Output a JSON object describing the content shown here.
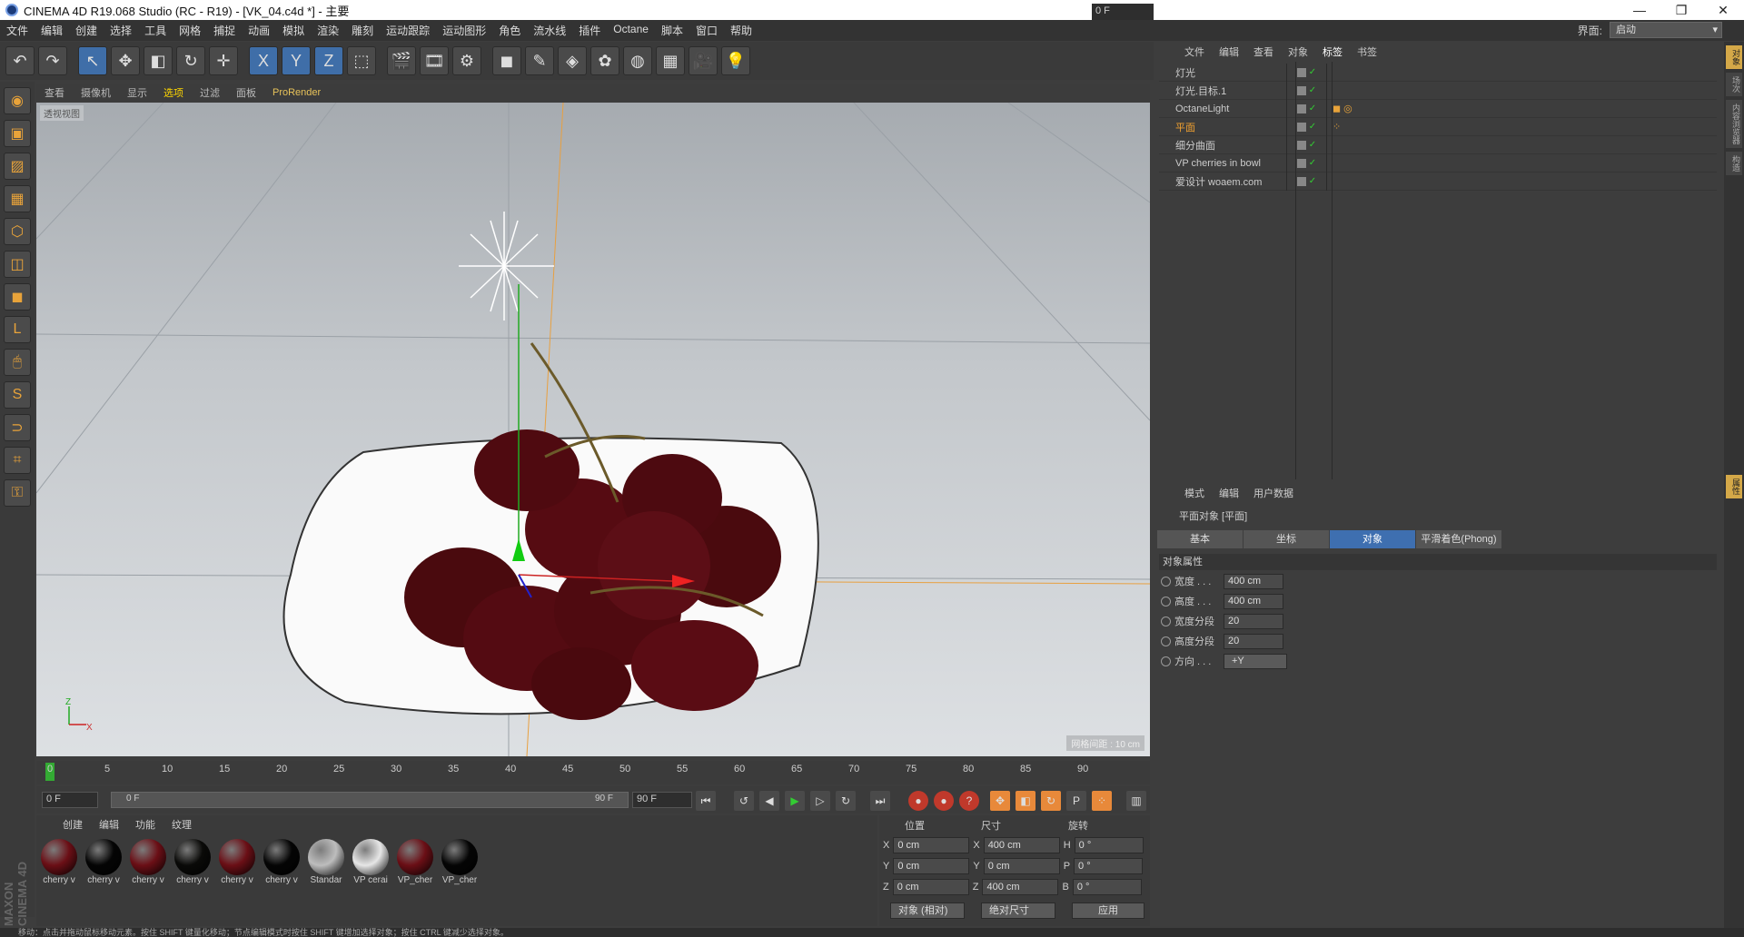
{
  "window": {
    "title": "CINEMA 4D R19.068 Studio (RC - R19) - [VK_04.c4d *] - 主要",
    "min": "—",
    "max": "❐",
    "close": "✕"
  },
  "menubar": {
    "items": [
      "文件",
      "编辑",
      "创建",
      "选择",
      "工具",
      "网格",
      "捕捉",
      "动画",
      "模拟",
      "渲染",
      "雕刻",
      "运动跟踪",
      "运动图形",
      "角色",
      "流水线",
      "插件",
      "Octane",
      "脚本",
      "窗口",
      "帮助"
    ],
    "interface_label": "界面:",
    "interface_value": "启动"
  },
  "toolbar": {
    "icons": [
      "undo-icon",
      "redo-icon",
      "select-icon",
      "move-icon",
      "scale-icon",
      "rotate-icon",
      "recent-icon",
      "x-axis-icon",
      "y-axis-icon",
      "z-axis-icon",
      "coord-system-icon",
      "render-view-icon",
      "render-picture-icon",
      "render-settings-icon",
      "cube-icon",
      "pen-icon",
      "subdivision-icon",
      "cloner-icon",
      "deformer-icon",
      "floor-icon",
      "camera-icon",
      "light-icon"
    ],
    "glyphs": [
      "↶",
      "↷",
      "↖",
      "✥",
      "◧",
      "↻",
      "✛",
      "X",
      "Y",
      "Z",
      "⬚",
      "🎬",
      "🎞",
      "⚙",
      "◼",
      "✎",
      "◈",
      "✿",
      "◍",
      "▦",
      "🎥",
      "💡"
    ]
  },
  "lefttools": {
    "icons": [
      "make-editable-icon",
      "model-mode-icon",
      "texture-mode-icon",
      "workplane-icon",
      "points-mode-icon",
      "edges-mode-icon",
      "polygons-mode-icon",
      "axis-mode-icon",
      "tweak-mode-icon",
      "solo-icon",
      "magnet-icon",
      "snap-icon",
      "lock-icon"
    ],
    "glyphs": [
      "◉",
      "▣",
      "▨",
      "▦",
      "⬡",
      "◫",
      "◼",
      "L",
      "🖱",
      "S",
      "⊃",
      "⌗",
      "⚿"
    ]
  },
  "maxon_logo": "MAXON CINEMA 4D",
  "viewport": {
    "menu": [
      "查看",
      "摄像机",
      "显示",
      "选项",
      "过滤",
      "面板",
      "ProRender"
    ],
    "active_menu": "选项",
    "label": "透视视图",
    "grid_label": "网格间距 : 10 cm",
    "axis_x": "X",
    "axis_y": "Z"
  },
  "timeline": {
    "ticks": [
      "0",
      "5",
      "10",
      "15",
      "20",
      "25",
      "30",
      "35",
      "40",
      "45",
      "50",
      "55",
      "60",
      "65",
      "70",
      "75",
      "80",
      "85",
      "90"
    ],
    "current": "0 F"
  },
  "playbar": {
    "start": "0 F",
    "range_start": "0 F",
    "range_end": "90 F",
    "end": "90 F"
  },
  "materials": {
    "menu": [
      "创建",
      "编辑",
      "功能",
      "纹理"
    ],
    "items": [
      {
        "label": "cherry v",
        "color": "#6b0f16"
      },
      {
        "label": "cherry v",
        "color": "#050505"
      },
      {
        "label": "cherry v",
        "color": "#6b0f16"
      },
      {
        "label": "cherry v",
        "color": "#0a0a08"
      },
      {
        "label": "cherry v",
        "color": "#6b0f16"
      },
      {
        "label": "cherry v",
        "color": "#050505"
      },
      {
        "label": "Standar",
        "color": "#bdbdbd"
      },
      {
        "label": "VP cerai",
        "color": "#e6e6e6"
      },
      {
        "label": "VP_cher",
        "color": "#6b0f16"
      },
      {
        "label": "VP_cher",
        "color": "#050505"
      }
    ]
  },
  "coords": {
    "headers": [
      "位置",
      "尺寸",
      "旋转"
    ],
    "rows": [
      {
        "axis": "X",
        "pos": "0 cm",
        "saxis": "X",
        "size": "400 cm",
        "raxis": "H",
        "rot": "0 °"
      },
      {
        "axis": "Y",
        "pos": "0 cm",
        "saxis": "Y",
        "size": "0 cm",
        "raxis": "P",
        "rot": "0 °"
      },
      {
        "axis": "Z",
        "pos": "0 cm",
        "saxis": "Z",
        "size": "400 cm",
        "raxis": "B",
        "rot": "0 °"
      }
    ],
    "mode": "对象 (相对)",
    "size_mode": "绝对尺寸",
    "apply": "应用"
  },
  "objects": {
    "menu": [
      "文件",
      "编辑",
      "查看",
      "对象",
      "标签",
      "书签"
    ],
    "active_menu": "标签",
    "items": [
      {
        "name": "灯光",
        "orange": false,
        "tags": ""
      },
      {
        "name": "灯光.目标.1",
        "orange": false,
        "tags": ""
      },
      {
        "name": "OctaneLight",
        "orange": false,
        "tags": "◼ ◎"
      },
      {
        "name": "平面",
        "orange": true,
        "tags": "⁘"
      },
      {
        "name": "细分曲面",
        "orange": false,
        "tags": ""
      },
      {
        "name": "VP cherries in bowl",
        "orange": false,
        "tags": ""
      },
      {
        "name": "爱设计 woaem.com",
        "orange": false,
        "tags": ""
      }
    ]
  },
  "attributes": {
    "menu": [
      "模式",
      "编辑",
      "用户数据"
    ],
    "object_title": "平面对象 [平面]",
    "tabs": [
      "基本",
      "坐标",
      "对象",
      "平滑着色(Phong)"
    ],
    "active_tab": "对象",
    "section": "对象属性",
    "fields": [
      {
        "label": "宽度 . . .",
        "value": "400 cm"
      },
      {
        "label": "高度 . . .",
        "value": "400 cm"
      },
      {
        "label": "宽度分段",
        "value": "20"
      },
      {
        "label": "高度分段",
        "value": "20"
      }
    ],
    "orientation_label": "方向 . . .",
    "orientation_value": "+Y"
  },
  "rightstrip": [
    "对象",
    "场次",
    "内容浏览器",
    "构造"
  ],
  "rightstrip_bottom": "属性",
  "statusbar": "移动：点击并拖动鼠标移动元素。按住 SHIFT 键量化移动；节点编辑模式时按住 SHIFT 键增加选择对象；按住 CTRL 键减少选择对象。",
  "colors": {
    "accent": "#3e6fb0",
    "orange": "#f0a030",
    "viewport_bg": "#c3c7cb"
  }
}
